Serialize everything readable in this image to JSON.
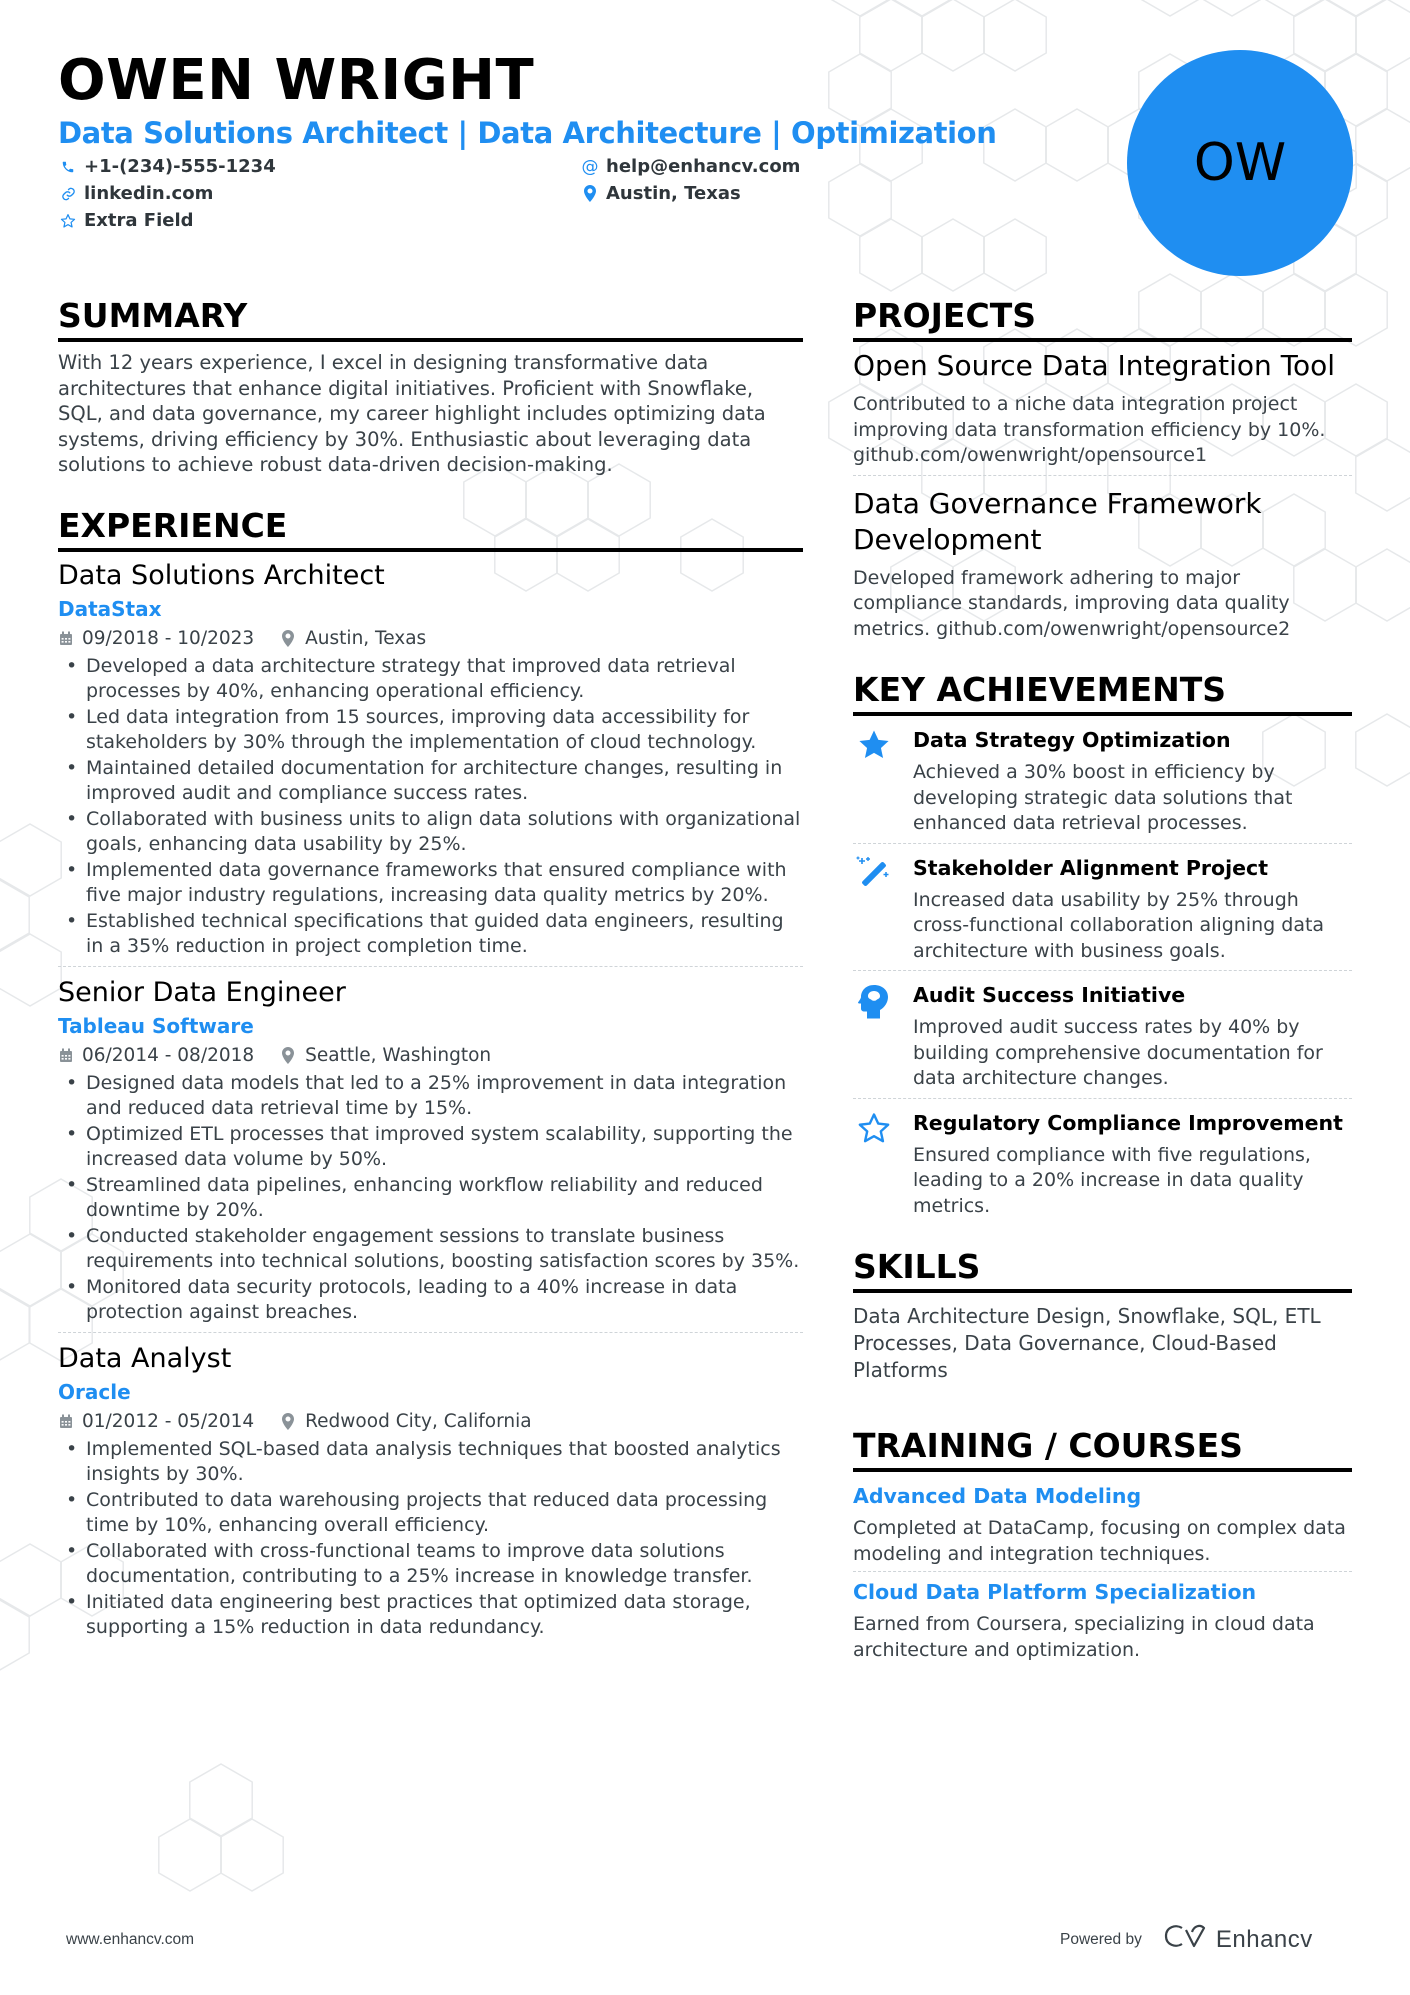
{
  "header": {
    "name": "OWEN WRIGHT",
    "title": "Data Solutions Architect | Data Architecture | Optimization",
    "initials": "OW",
    "contacts": {
      "phone": {
        "icon": "phone-icon",
        "value": "+1-(234)-555-1234"
      },
      "email": {
        "icon": "at-icon",
        "value": "help@enhancv.com"
      },
      "linkedin": {
        "icon": "link-icon",
        "value": "linkedin.com"
      },
      "location": {
        "icon": "map-pin-icon",
        "value": "Austin, Texas"
      },
      "extra": {
        "icon": "star-outline-icon",
        "value": "Extra Field"
      }
    }
  },
  "summary": {
    "heading": "SUMMARY",
    "text": "With 12 years experience, I excel in designing transformative data architectures that enhance digital initiatives. Proficient with Snowflake, SQL, and data governance, my career highlight includes optimizing data systems, driving efficiency by 30%. Enthusiastic about leveraging data solutions to achieve robust data-driven decision-making."
  },
  "experience": {
    "heading": "EXPERIENCE",
    "jobs": [
      {
        "title": "Data Solutions Architect",
        "company": "DataStax",
        "dates": "09/2018 - 10/2023",
        "location": "Austin, Texas",
        "bullets": [
          "Developed a data architecture strategy that improved data retrieval processes by 40%, enhancing operational efficiency.",
          "Led data integration from 15 sources, improving data accessibility for stakeholders by 30% through the implementation of cloud technology.",
          "Maintained detailed documentation for architecture changes, resulting in improved audit and compliance success rates.",
          "Collaborated with business units to align data solutions with organizational goals, enhancing data usability by 25%.",
          "Implemented data governance frameworks that ensured compliance with five major industry regulations, increasing data quality metrics by 20%.",
          "Established technical specifications that guided data engineers, resulting in a 35% reduction in project completion time."
        ]
      },
      {
        "title": "Senior Data Engineer",
        "company": "Tableau Software",
        "dates": "06/2014 - 08/2018",
        "location": "Seattle, Washington",
        "bullets": [
          "Designed data models that led to a 25% improvement in data integration and reduced data retrieval time by 15%.",
          "Optimized ETL processes that improved system scalability, supporting the increased data volume by 50%.",
          "Streamlined data pipelines, enhancing workflow reliability and reduced downtime by 20%.",
          "Conducted stakeholder engagement sessions to translate business requirements into technical solutions, boosting satisfaction scores by 35%.",
          "Monitored data security protocols, leading to a 40% increase in data protection against breaches."
        ]
      },
      {
        "title": "Data Analyst",
        "company": "Oracle",
        "dates": "01/2012 - 05/2014",
        "location": "Redwood City, California",
        "bullets": [
          "Implemented SQL-based data analysis techniques that boosted analytics insights by 30%.",
          "Contributed to data warehousing projects that reduced data processing time by 10%, enhancing overall efficiency.",
          "Collaborated with cross-functional teams to improve data solutions documentation, contributing to a 25% increase in knowledge transfer.",
          "Initiated data engineering best practices that optimized data storage, supporting a 15% reduction in data redundancy."
        ]
      }
    ]
  },
  "projects": {
    "heading": "PROJECTS",
    "items": [
      {
        "title": "Open Source Data Integration Tool",
        "description": "Contributed to a niche data integration project improving data transformation efficiency by 10%. github.com/owenwright/opensource1"
      },
      {
        "title": "Data Governance Framework Development",
        "description": "Developed framework adhering to major compliance standards, improving data quality metrics. github.com/owenwright/opensource2"
      }
    ]
  },
  "achievements": {
    "heading": "KEY ACHIEVEMENTS",
    "items": [
      {
        "icon": "star-filled-icon",
        "title": "Data Strategy Optimization",
        "description": "Achieved a 30% boost in efficiency by developing strategic data solutions that enhanced data retrieval processes."
      },
      {
        "icon": "magic-wand-icon",
        "title": "Stakeholder Alignment Project",
        "description": "Increased data usability by 25% through cross-functional collaboration aligning data architecture with business goals."
      },
      {
        "icon": "brain-head-icon",
        "title": "Audit Success Initiative",
        "description": "Improved audit success rates by 40% by building comprehensive documentation for data architecture changes."
      },
      {
        "icon": "star-outline-icon",
        "title": "Regulatory Compliance Improvement",
        "description": "Ensured compliance with five regulations, leading to a 20% increase in data quality metrics."
      }
    ]
  },
  "skills": {
    "heading": "SKILLS",
    "text": "Data Architecture Design, Snowflake, SQL, ETL Processes, Data Governance, Cloud-Based Platforms"
  },
  "training": {
    "heading": "TRAINING / COURSES",
    "items": [
      {
        "title": "Advanced Data Modeling",
        "description": "Completed at DataCamp, focusing on complex data modeling and integration techniques."
      },
      {
        "title": "Cloud Data Platform Specialization",
        "description": "Earned from Coursera, specializing in cloud data architecture and optimization."
      }
    ]
  },
  "footer": {
    "website": "www.enhancv.com",
    "powered_by": "Powered by",
    "brand": "Enhancv"
  },
  "colors": {
    "accent": "#1f8ef1",
    "text": "#3a4248",
    "heading": "#000000"
  }
}
